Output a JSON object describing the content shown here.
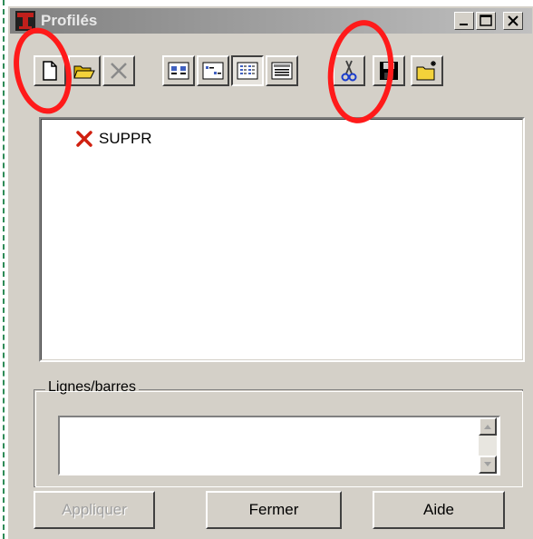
{
  "window": {
    "title": "Profilés"
  },
  "title_buttons": [
    "minimize",
    "maximize",
    "close"
  ],
  "toolbar": {
    "items": [
      {
        "name": "new-icon"
      },
      {
        "name": "open-folder-icon"
      },
      {
        "name": "delete-x-icon"
      },
      {
        "name": "view-large-icons-icon"
      },
      {
        "name": "view-small-icons-icon"
      },
      {
        "name": "view-list-icon"
      },
      {
        "name": "view-details-icon"
      },
      {
        "name": "cut-scissors-icon"
      },
      {
        "name": "save-disk-icon"
      },
      {
        "name": "new-folder-icon"
      }
    ]
  },
  "list": {
    "items": [
      {
        "label": "SUPPR",
        "icon": "red-x-icon"
      }
    ]
  },
  "group": {
    "label": "Lignes/barres",
    "value": ""
  },
  "buttons": {
    "apply": "Appliquer",
    "close": "Fermer",
    "help": "Aide"
  },
  "colors": {
    "annotation": "#ff1a1a",
    "face": "#d4d0c8"
  }
}
